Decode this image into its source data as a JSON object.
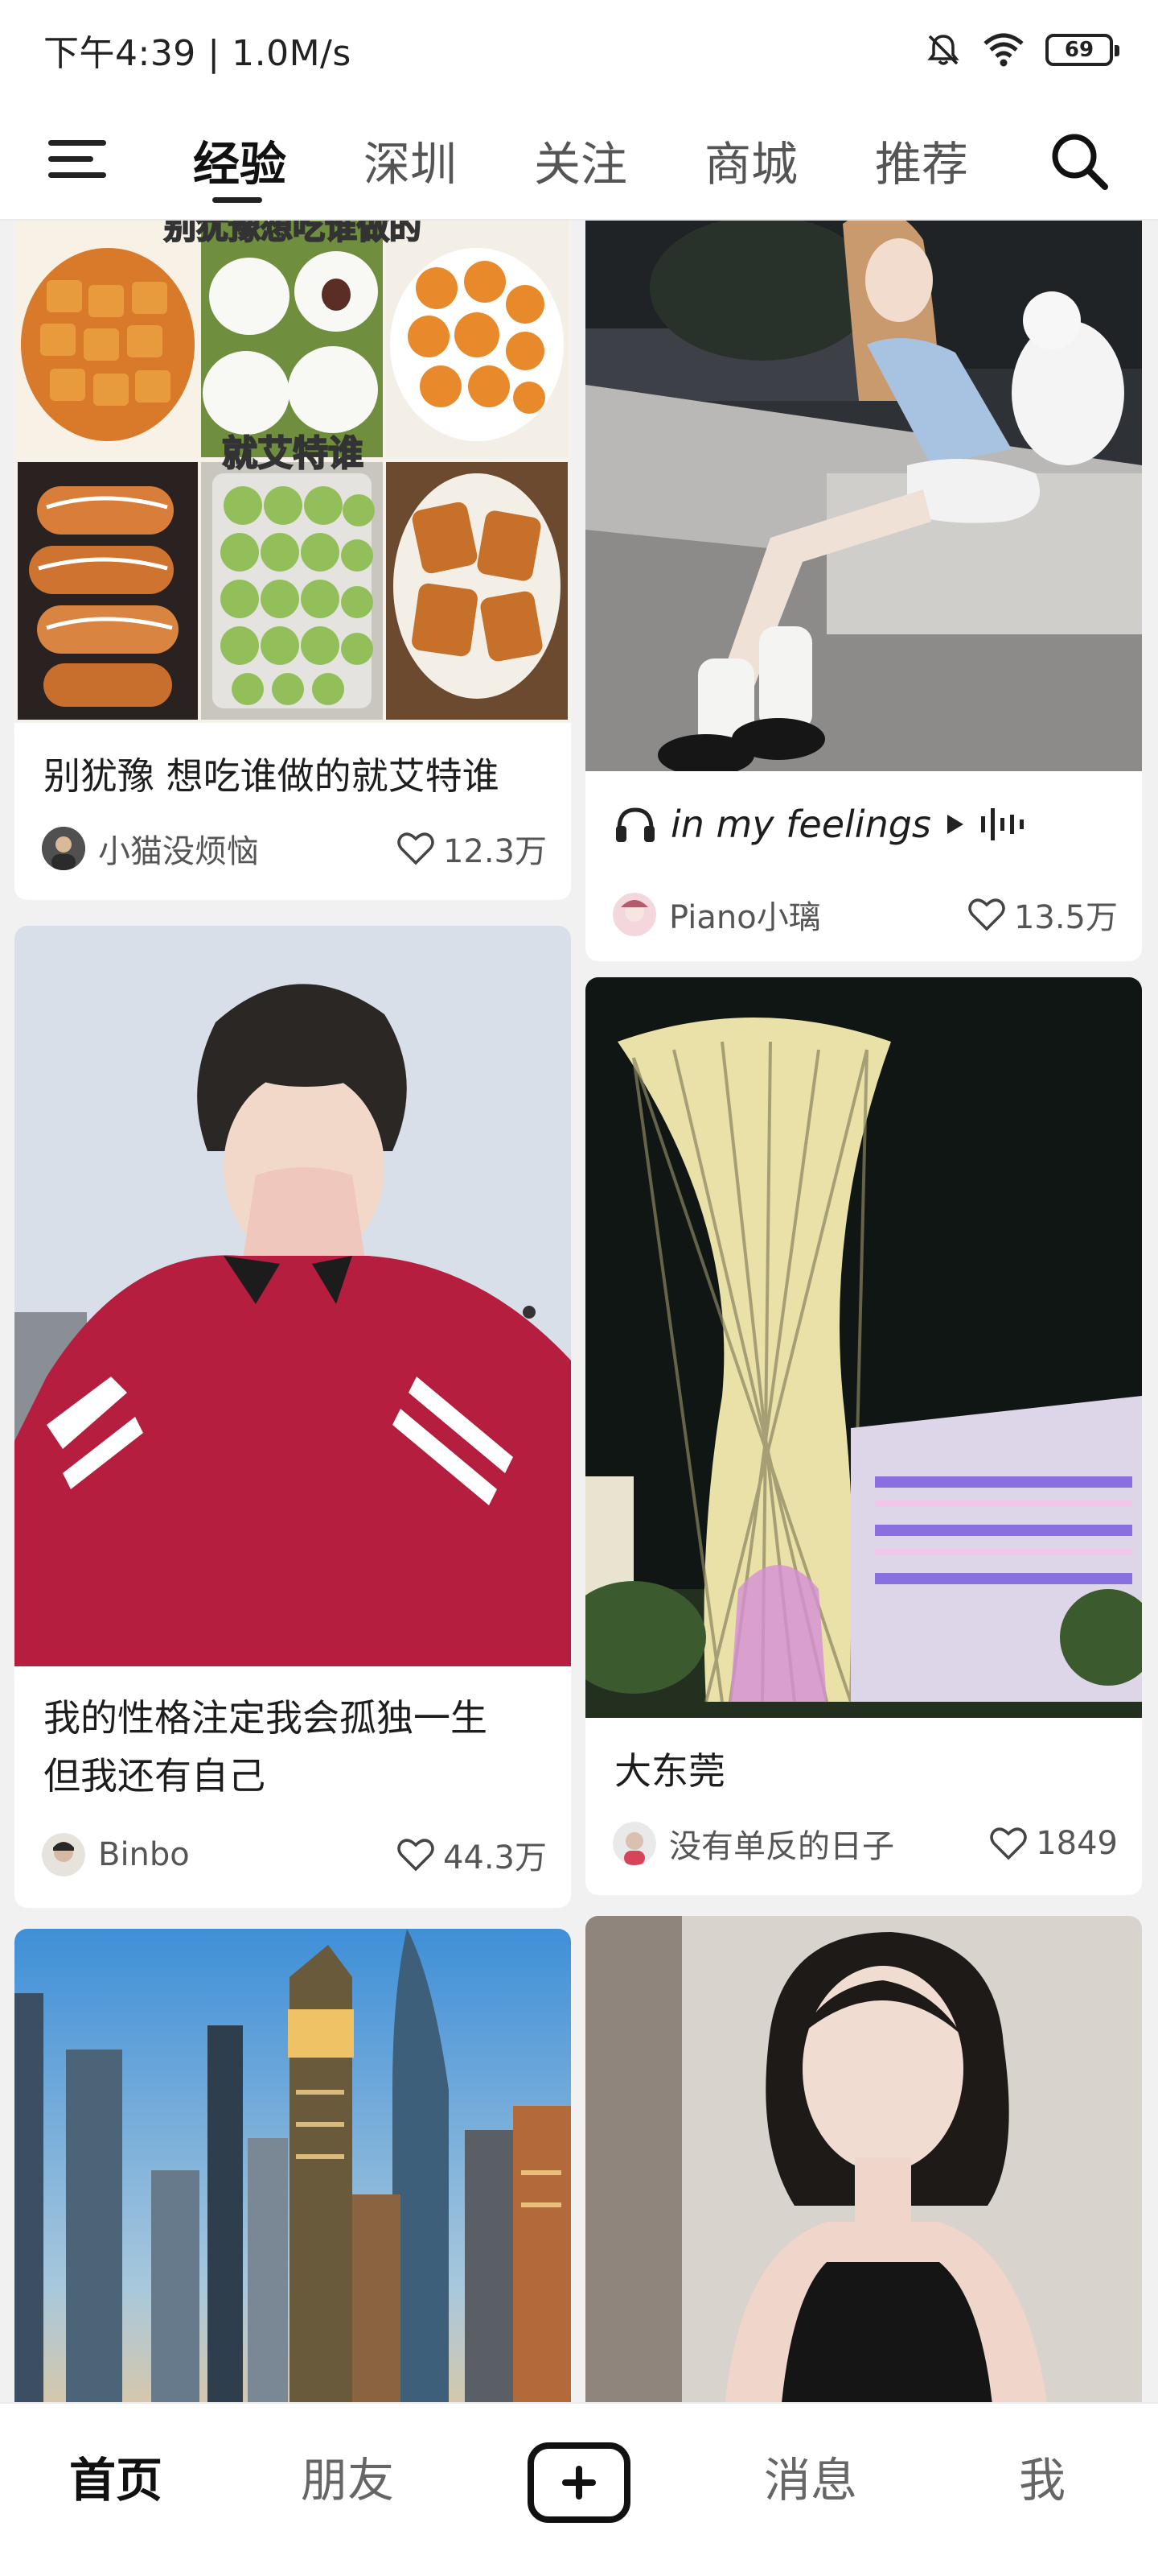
{
  "status_bar": {
    "time_speed": "下午4:39 | 1.0M/s",
    "battery": "69"
  },
  "top_nav": {
    "tabs": [
      {
        "label": "经验",
        "active": true
      },
      {
        "label": "深圳",
        "active": false
      },
      {
        "label": "关注",
        "active": false
      },
      {
        "label": "商城",
        "active": false
      },
      {
        "label": "推荐",
        "active": false
      }
    ],
    "menu_icon": "hamburger-menu-icon",
    "search_icon": "search-icon"
  },
  "feed": {
    "cards": [
      {
        "image_text_top": "别犹豫想吃谁做的",
        "image_text_mid": "就艾特谁",
        "title": "别犹豫 想吃谁做的就艾特谁",
        "author": "小猫没烦恼",
        "likes": "12.3万"
      },
      {
        "title": "in my feelings",
        "author": "Piano小璃",
        "likes": "13.5万"
      },
      {
        "title_line1": "我的性格注定我会孤独一生",
        "title_line2": "但我还有自己",
        "author": "Binbo",
        "likes": "44.3万"
      },
      {
        "title": "大东莞",
        "author": "没有单反的日子",
        "likes": "1849"
      }
    ]
  },
  "bottom_nav": {
    "home": "首页",
    "friends": "朋友",
    "messages": "消息",
    "me": "我"
  },
  "colors": {
    "background": "#f1f1f1",
    "card": "#ffffff",
    "text": "#222222"
  }
}
